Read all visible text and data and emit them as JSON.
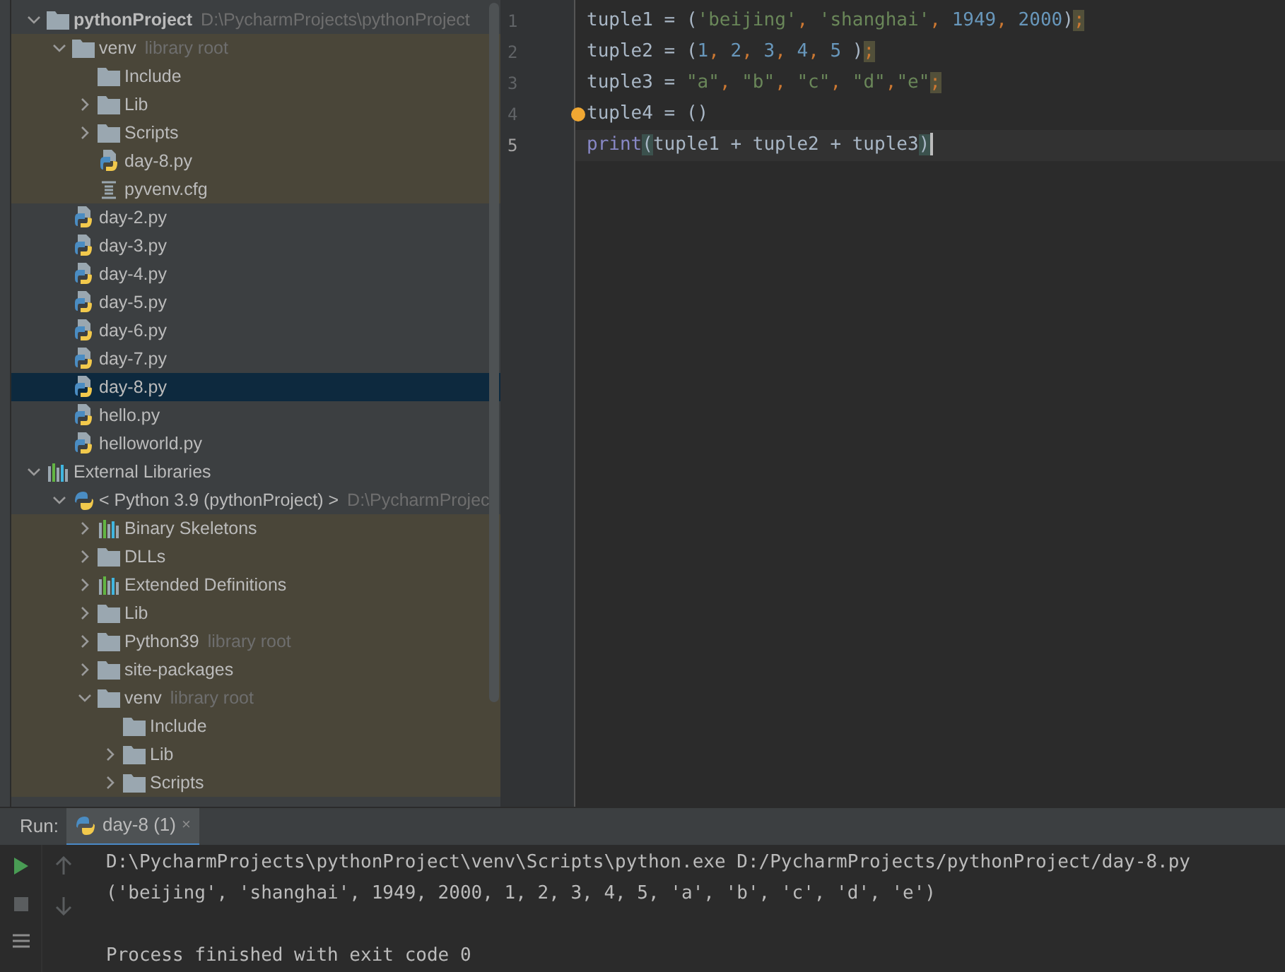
{
  "project_tree": [
    {
      "label": "pythonProject",
      "hint": "D:\\PycharmProjects\\pythonProject",
      "kind": "folder",
      "bold": true,
      "expanded": true,
      "tinted": false,
      "selected": false,
      "children": [
        {
          "label": "venv",
          "hint": "library root",
          "kind": "folder",
          "expanded": true,
          "tinted": true,
          "selected": false,
          "children": [
            {
              "label": "Include",
              "kind": "folder",
              "tinted": true,
              "selected": false
            },
            {
              "label": "Lib",
              "kind": "folder",
              "expanded": false,
              "tinted": true,
              "selected": false
            },
            {
              "label": "Scripts",
              "kind": "folder",
              "expanded": false,
              "tinted": true,
              "selected": false
            },
            {
              "label": "day-8.py",
              "kind": "python",
              "tinted": true,
              "selected": false
            },
            {
              "label": "pyvenv.cfg",
              "kind": "config",
              "tinted": true,
              "selected": false
            }
          ]
        },
        {
          "label": "day-2.py",
          "kind": "python",
          "tinted": false,
          "selected": false
        },
        {
          "label": "day-3.py",
          "kind": "python",
          "tinted": false,
          "selected": false
        },
        {
          "label": "day-4.py",
          "kind": "python",
          "tinted": false,
          "selected": false
        },
        {
          "label": "day-5.py",
          "kind": "python",
          "tinted": false,
          "selected": false
        },
        {
          "label": "day-6.py",
          "kind": "python",
          "tinted": false,
          "selected": false
        },
        {
          "label": "day-7.py",
          "kind": "python",
          "tinted": false,
          "selected": false
        },
        {
          "label": "day-8.py",
          "kind": "python",
          "tinted": false,
          "selected": true
        },
        {
          "label": "hello.py",
          "kind": "python",
          "tinted": false,
          "selected": false
        },
        {
          "label": "helloworld.py",
          "kind": "python",
          "tinted": false,
          "selected": false
        }
      ]
    },
    {
      "label": "External Libraries",
      "kind": "library",
      "expanded": true,
      "tinted": false,
      "selected": false,
      "children": [
        {
          "label": "< Python 3.9 (pythonProject) >",
          "hint": "D:\\PycharmProjec",
          "kind": "sdk",
          "expanded": true,
          "tinted": false,
          "selected": false,
          "children": [
            {
              "label": "Binary Skeletons",
              "kind": "library",
              "expanded": false,
              "tinted": true,
              "selected": false
            },
            {
              "label": "DLLs",
              "kind": "folder",
              "expanded": false,
              "tinted": true,
              "selected": false
            },
            {
              "label": "Extended Definitions",
              "kind": "library",
              "expanded": false,
              "tinted": true,
              "selected": false
            },
            {
              "label": "Lib",
              "kind": "folder",
              "expanded": false,
              "tinted": true,
              "selected": false
            },
            {
              "label": "Python39",
              "hint": "library root",
              "kind": "folder",
              "expanded": false,
              "tinted": true,
              "selected": false
            },
            {
              "label": "site-packages",
              "kind": "folder",
              "expanded": false,
              "tinted": true,
              "selected": false
            },
            {
              "label": "venv",
              "hint": "library root",
              "kind": "folder",
              "expanded": true,
              "tinted": true,
              "selected": false,
              "children": [
                {
                  "label": "Include",
                  "kind": "folder",
                  "tinted": true,
                  "selected": false
                },
                {
                  "label": "Lib",
                  "kind": "folder",
                  "expanded": false,
                  "tinted": true,
                  "selected": false
                },
                {
                  "label": "Scripts",
                  "kind": "folder",
                  "expanded": false,
                  "tinted": true,
                  "selected": false
                }
              ]
            }
          ]
        }
      ]
    }
  ],
  "editor": {
    "lines": [
      {
        "number": "1",
        "current": false,
        "tokens": [
          {
            "text": "tuple1 = (",
            "kind": "plain"
          },
          {
            "text": "'beijing'",
            "kind": "string"
          },
          {
            "text": ", ",
            "kind": "comma"
          },
          {
            "text": "'shanghai'",
            "kind": "string"
          },
          {
            "text": ", ",
            "kind": "comma"
          },
          {
            "text": "1949",
            "kind": "number"
          },
          {
            "text": ", ",
            "kind": "comma"
          },
          {
            "text": "2000",
            "kind": "number"
          },
          {
            "text": ")",
            "kind": "plain"
          },
          {
            "text": ";",
            "kind": "warn"
          }
        ]
      },
      {
        "number": "2",
        "current": false,
        "tokens": [
          {
            "text": "tuple2 = (",
            "kind": "plain"
          },
          {
            "text": "1",
            "kind": "number"
          },
          {
            "text": ", ",
            "kind": "comma"
          },
          {
            "text": "2",
            "kind": "number"
          },
          {
            "text": ", ",
            "kind": "comma"
          },
          {
            "text": "3",
            "kind": "number"
          },
          {
            "text": ", ",
            "kind": "comma"
          },
          {
            "text": "4",
            "kind": "number"
          },
          {
            "text": ", ",
            "kind": "comma"
          },
          {
            "text": "5",
            "kind": "number"
          },
          {
            "text": " )",
            "kind": "plain"
          },
          {
            "text": ";",
            "kind": "warn"
          }
        ]
      },
      {
        "number": "3",
        "current": false,
        "tokens": [
          {
            "text": "tuple3 = ",
            "kind": "plain"
          },
          {
            "text": "\"a\"",
            "kind": "string"
          },
          {
            "text": ", ",
            "kind": "comma"
          },
          {
            "text": "\"b\"",
            "kind": "string"
          },
          {
            "text": ", ",
            "kind": "comma"
          },
          {
            "text": "\"c\"",
            "kind": "string"
          },
          {
            "text": ", ",
            "kind": "comma"
          },
          {
            "text": "\"d\"",
            "kind": "string"
          },
          {
            "text": ",",
            "kind": "comma"
          },
          {
            "text": "\"e\"",
            "kind": "string"
          },
          {
            "text": ";",
            "kind": "warn"
          }
        ]
      },
      {
        "number": "4",
        "current": false,
        "bulb": true,
        "tokens": [
          {
            "text": "tuple4 = ()",
            "kind": "plain"
          }
        ]
      },
      {
        "number": "5",
        "current": true,
        "tokens": [
          {
            "text": "print",
            "kind": "builtin"
          },
          {
            "text": "(",
            "kind": "brace"
          },
          {
            "text": "tuple1 + tuple2 + tuple3",
            "kind": "plain"
          },
          {
            "text": ")",
            "kind": "brace"
          }
        ]
      }
    ]
  },
  "run_panel": {
    "label": "Run:",
    "tab": {
      "label": "day-8 (1)",
      "close": "×",
      "selected": true
    },
    "output": [
      {
        "text": "D:\\PycharmProjects\\pythonProject\\venv\\Scripts\\python.exe D:/PycharmProjects/pythonProject/day-8.py",
        "blank_before": false
      },
      {
        "text": "('beijing', 'shanghai', 1949, 2000, 1, 2, 3, 4, 5, 'a', 'b', 'c', 'd', 'e')",
        "blank_before": false
      },
      {
        "text": "Process finished with exit code 0",
        "blank_before": true
      }
    ]
  }
}
